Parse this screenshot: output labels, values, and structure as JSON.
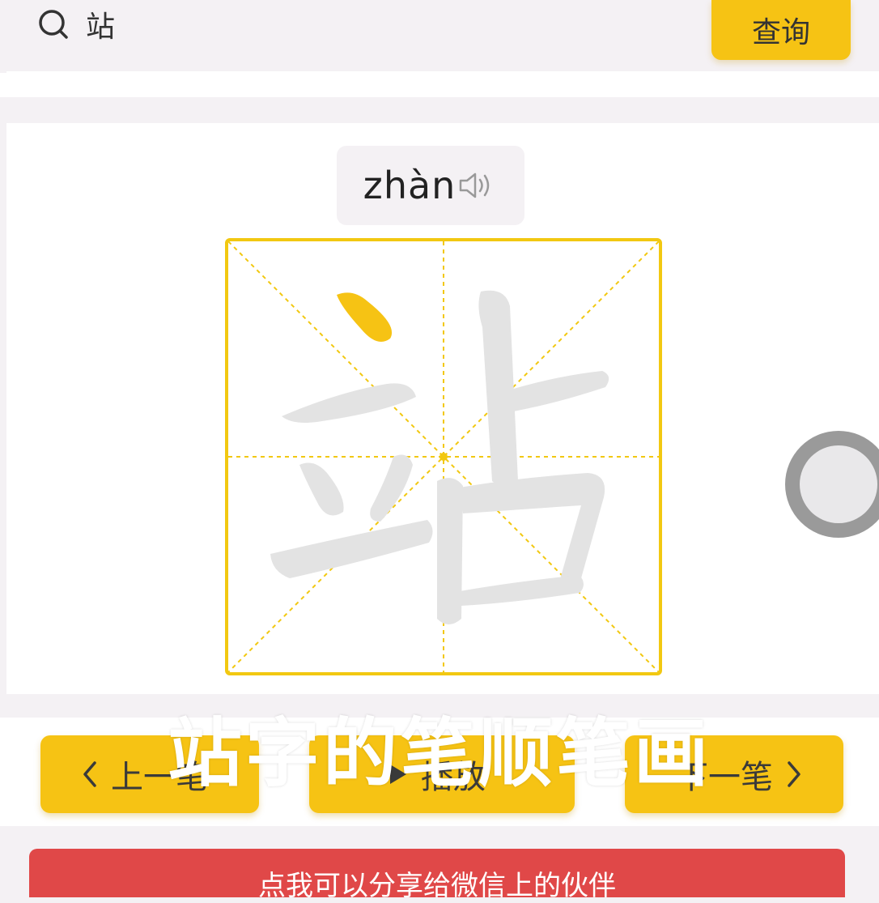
{
  "search": {
    "icon": "search-icon",
    "value": "站",
    "button_label": "查询"
  },
  "character": {
    "pinyin": "zhàn",
    "speaker_icon": "speaker-icon",
    "glyph": "站",
    "highlight_color": "#f6c314",
    "guide_color": "#f2c811",
    "ghost_color": "#e3e3e3",
    "strokes_highlighted": 1
  },
  "controls": {
    "prev_label": "上一笔",
    "prev_icon": "chevron-left-icon",
    "play_label": "播放",
    "play_icon": "play-icon",
    "next_label": "下一笔",
    "next_icon": "chevron-right-icon"
  },
  "overlay": {
    "caption": "站字的笔顺笔画"
  },
  "share": {
    "label": "点我可以分享给微信上的伙伴"
  },
  "colors": {
    "accent": "#f6c314",
    "share_bg": "#e04848",
    "page_bg": "#f4f1f4"
  }
}
